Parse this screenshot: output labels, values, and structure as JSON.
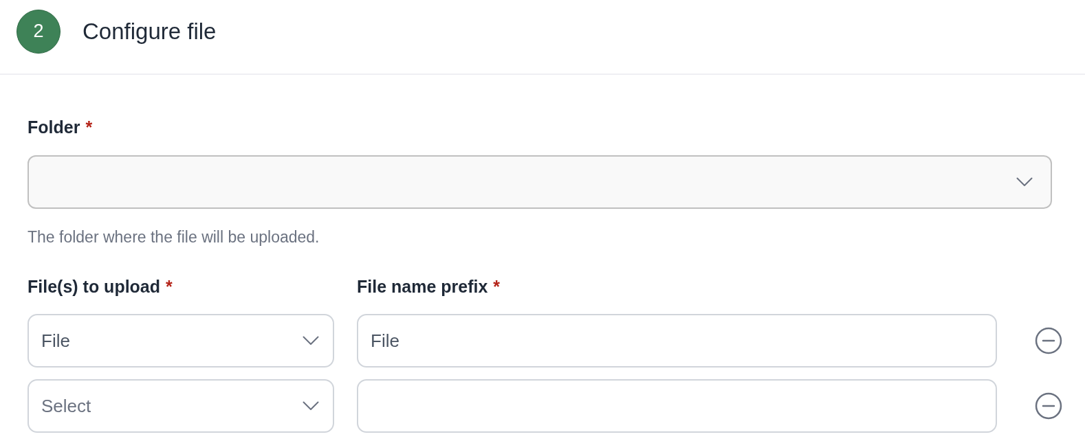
{
  "step": {
    "number": "2",
    "title": "Configure file"
  },
  "folder": {
    "label": "Folder",
    "required_mark": "*",
    "help": "The folder where the file will be uploaded."
  },
  "files": {
    "columns": [
      {
        "label": "File(s) to upload",
        "required_mark": "*"
      },
      {
        "label": "File name prefix",
        "required_mark": "*"
      }
    ],
    "rows": [
      {
        "file": {
          "value": "File"
        },
        "prefix": {
          "value": "File"
        }
      },
      {
        "file": {
          "placeholder": "Select"
        },
        "prefix": {}
      }
    ]
  }
}
